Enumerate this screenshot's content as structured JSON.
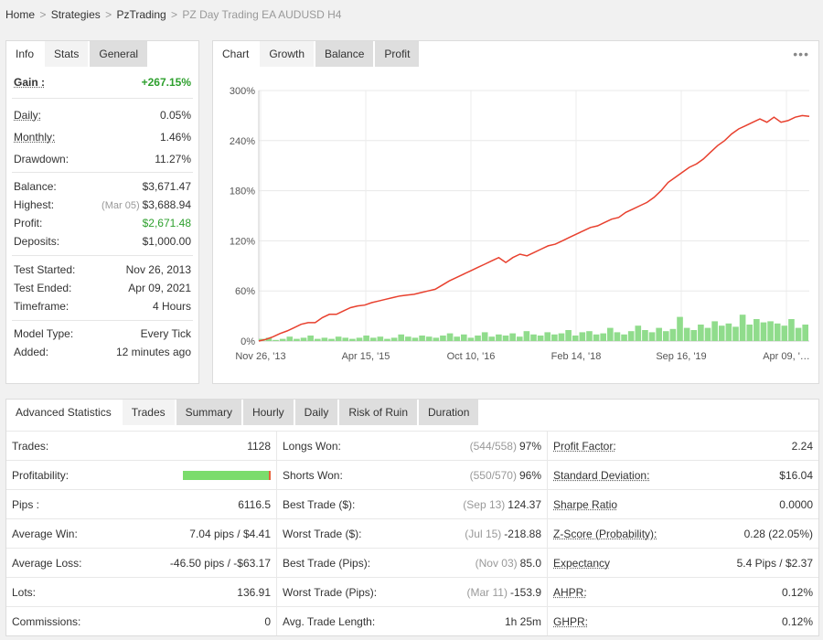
{
  "breadcrumb": {
    "home": "Home",
    "strategies": "Strategies",
    "vendor": "PzTrading",
    "current": "PZ Day Trading EA AUDUSD H4",
    "sep": ">"
  },
  "stats_tabs": [
    "Info",
    "Stats",
    "General"
  ],
  "stats": {
    "gain": {
      "label": "Gain :",
      "value": "+267.15%"
    },
    "daily": {
      "label": "Daily:",
      "value": "0.05%"
    },
    "monthly": {
      "label": "Monthly:",
      "value": "1.46%"
    },
    "drawdown": {
      "label": "Drawdown:",
      "value": "11.27%"
    },
    "balance": {
      "label": "Balance:",
      "value": "$3,671.47"
    },
    "highest": {
      "label": "Highest:",
      "date": "(Mar 05)",
      "value": "$3,688.94"
    },
    "profit": {
      "label": "Profit:",
      "value": "$2,671.48"
    },
    "deposits": {
      "label": "Deposits:",
      "value": "$1,000.00"
    },
    "test_started": {
      "label": "Test Started:",
      "value": "Nov 26, 2013"
    },
    "test_ended": {
      "label": "Test Ended:",
      "value": "Apr 09, 2021"
    },
    "timeframe": {
      "label": "Timeframe:",
      "value": "4 Hours"
    },
    "model_type": {
      "label": "Model Type:",
      "value": "Every Tick"
    },
    "added": {
      "label": "Added:",
      "value": "12 minutes ago"
    }
  },
  "chart_tabs": [
    "Chart",
    "Growth",
    "Balance",
    "Profit"
  ],
  "chart_menu": "•••",
  "chart_data": {
    "type": "line",
    "y_ticks": [
      "300%",
      "240%",
      "180%",
      "120%",
      "60%",
      "0%"
    ],
    "x_ticks": [
      "Nov 26, '13",
      "Apr 15, '15",
      "Oct 10, '16",
      "Feb 14, '18",
      "Sep 16, '19",
      "Apr 09, '…"
    ],
    "ylim": [
      0,
      300
    ],
    "line_color": "#e8402e",
    "bar_color": "#90dc8c",
    "series": [
      {
        "values": [
          0,
          2,
          5,
          9,
          12,
          16,
          20,
          22,
          22,
          28,
          32,
          32,
          36,
          40,
          42,
          43,
          46,
          48,
          50,
          52,
          54,
          55,
          56,
          58,
          60,
          62,
          67,
          72,
          76,
          80,
          84,
          88,
          92,
          96,
          100,
          94,
          100,
          104,
          102,
          106,
          110,
          114,
          116,
          120,
          124,
          128,
          132,
          136,
          138,
          142,
          146,
          148,
          154,
          158,
          162,
          166,
          172,
          180,
          190,
          196,
          202,
          208,
          212,
          218,
          226,
          234,
          240,
          248,
          254,
          258,
          262,
          266,
          262,
          268,
          262,
          264,
          268,
          270,
          269
        ]
      }
    ],
    "volume": [
      2,
      3,
      1,
      2,
      4,
      2,
      3,
      5,
      2,
      3,
      2,
      4,
      3,
      2,
      3,
      5,
      3,
      4,
      2,
      3,
      6,
      4,
      3,
      5,
      4,
      3,
      5,
      7,
      4,
      6,
      3,
      5,
      8,
      4,
      6,
      5,
      7,
      4,
      9,
      6,
      5,
      8,
      6,
      7,
      10,
      5,
      8,
      9,
      6,
      7,
      12,
      8,
      6,
      9,
      14,
      10,
      8,
      12,
      9,
      11,
      22,
      12,
      10,
      15,
      12,
      18,
      14,
      16,
      13,
      24,
      15,
      20,
      17,
      18,
      16,
      14,
      20,
      12,
      15
    ]
  },
  "adv_tabs": [
    "Advanced Statistics",
    "Trades",
    "Summary",
    "Hourly",
    "Daily",
    "Risk of Ruin",
    "Duration"
  ],
  "adv_rows": [
    {
      "c1": {
        "label": "Trades:",
        "value": "1128"
      },
      "c2": {
        "label": "Longs Won:",
        "muted": "(544/558)",
        "value": "97%"
      },
      "c3": {
        "label": "Profit Factor:",
        "value": "2.24",
        "underline": true
      }
    },
    {
      "c1": {
        "label": "Profitability:",
        "value": ""
      },
      "c2": {
        "label": "Shorts Won:",
        "muted": "(550/570)",
        "value": "96%"
      },
      "c3": {
        "label": "Standard Deviation:",
        "value": "$16.04",
        "underline": true
      }
    },
    {
      "c1": {
        "label": "Pips :",
        "value": "6116.5"
      },
      "c2": {
        "label": "Best Trade ($):",
        "muted": "(Sep 13)",
        "value": "124.37"
      },
      "c3": {
        "label": "Sharpe Ratio",
        "value": "0.0000",
        "underline": true
      }
    },
    {
      "c1": {
        "label": "Average Win:",
        "value": "7.04 pips / $4.41"
      },
      "c2": {
        "label": "Worst Trade ($):",
        "muted": "(Jul 15)",
        "value": "-218.88"
      },
      "c3": {
        "label": "Z-Score (Probability):",
        "value": "0.28 (22.05%)",
        "underline": true
      }
    },
    {
      "c1": {
        "label": "Average Loss:",
        "value": "-46.50 pips / -$63.17"
      },
      "c2": {
        "label": "Best Trade (Pips):",
        "muted": "(Nov 03)",
        "value": "85.0"
      },
      "c3": {
        "label": "Expectancy",
        "value": "5.4 Pips / $2.37",
        "underline": true
      }
    },
    {
      "c1": {
        "label": "Lots:",
        "value": "136.91"
      },
      "c2": {
        "label": "Worst Trade (Pips):",
        "muted": "(Mar 11)",
        "value": "-153.9"
      },
      "c3": {
        "label": "AHPR:",
        "value": "0.12%",
        "underline": true
      }
    },
    {
      "c1": {
        "label": "Commissions:",
        "value": "0"
      },
      "c2": {
        "label": "Avg. Trade Length:",
        "muted": "",
        "value": "1h 25m"
      },
      "c3": {
        "label": "GHPR:",
        "value": "0.12%",
        "underline": true
      }
    }
  ],
  "profitability": {
    "win_fraction": 0.975,
    "loss_fraction": 0.025
  }
}
